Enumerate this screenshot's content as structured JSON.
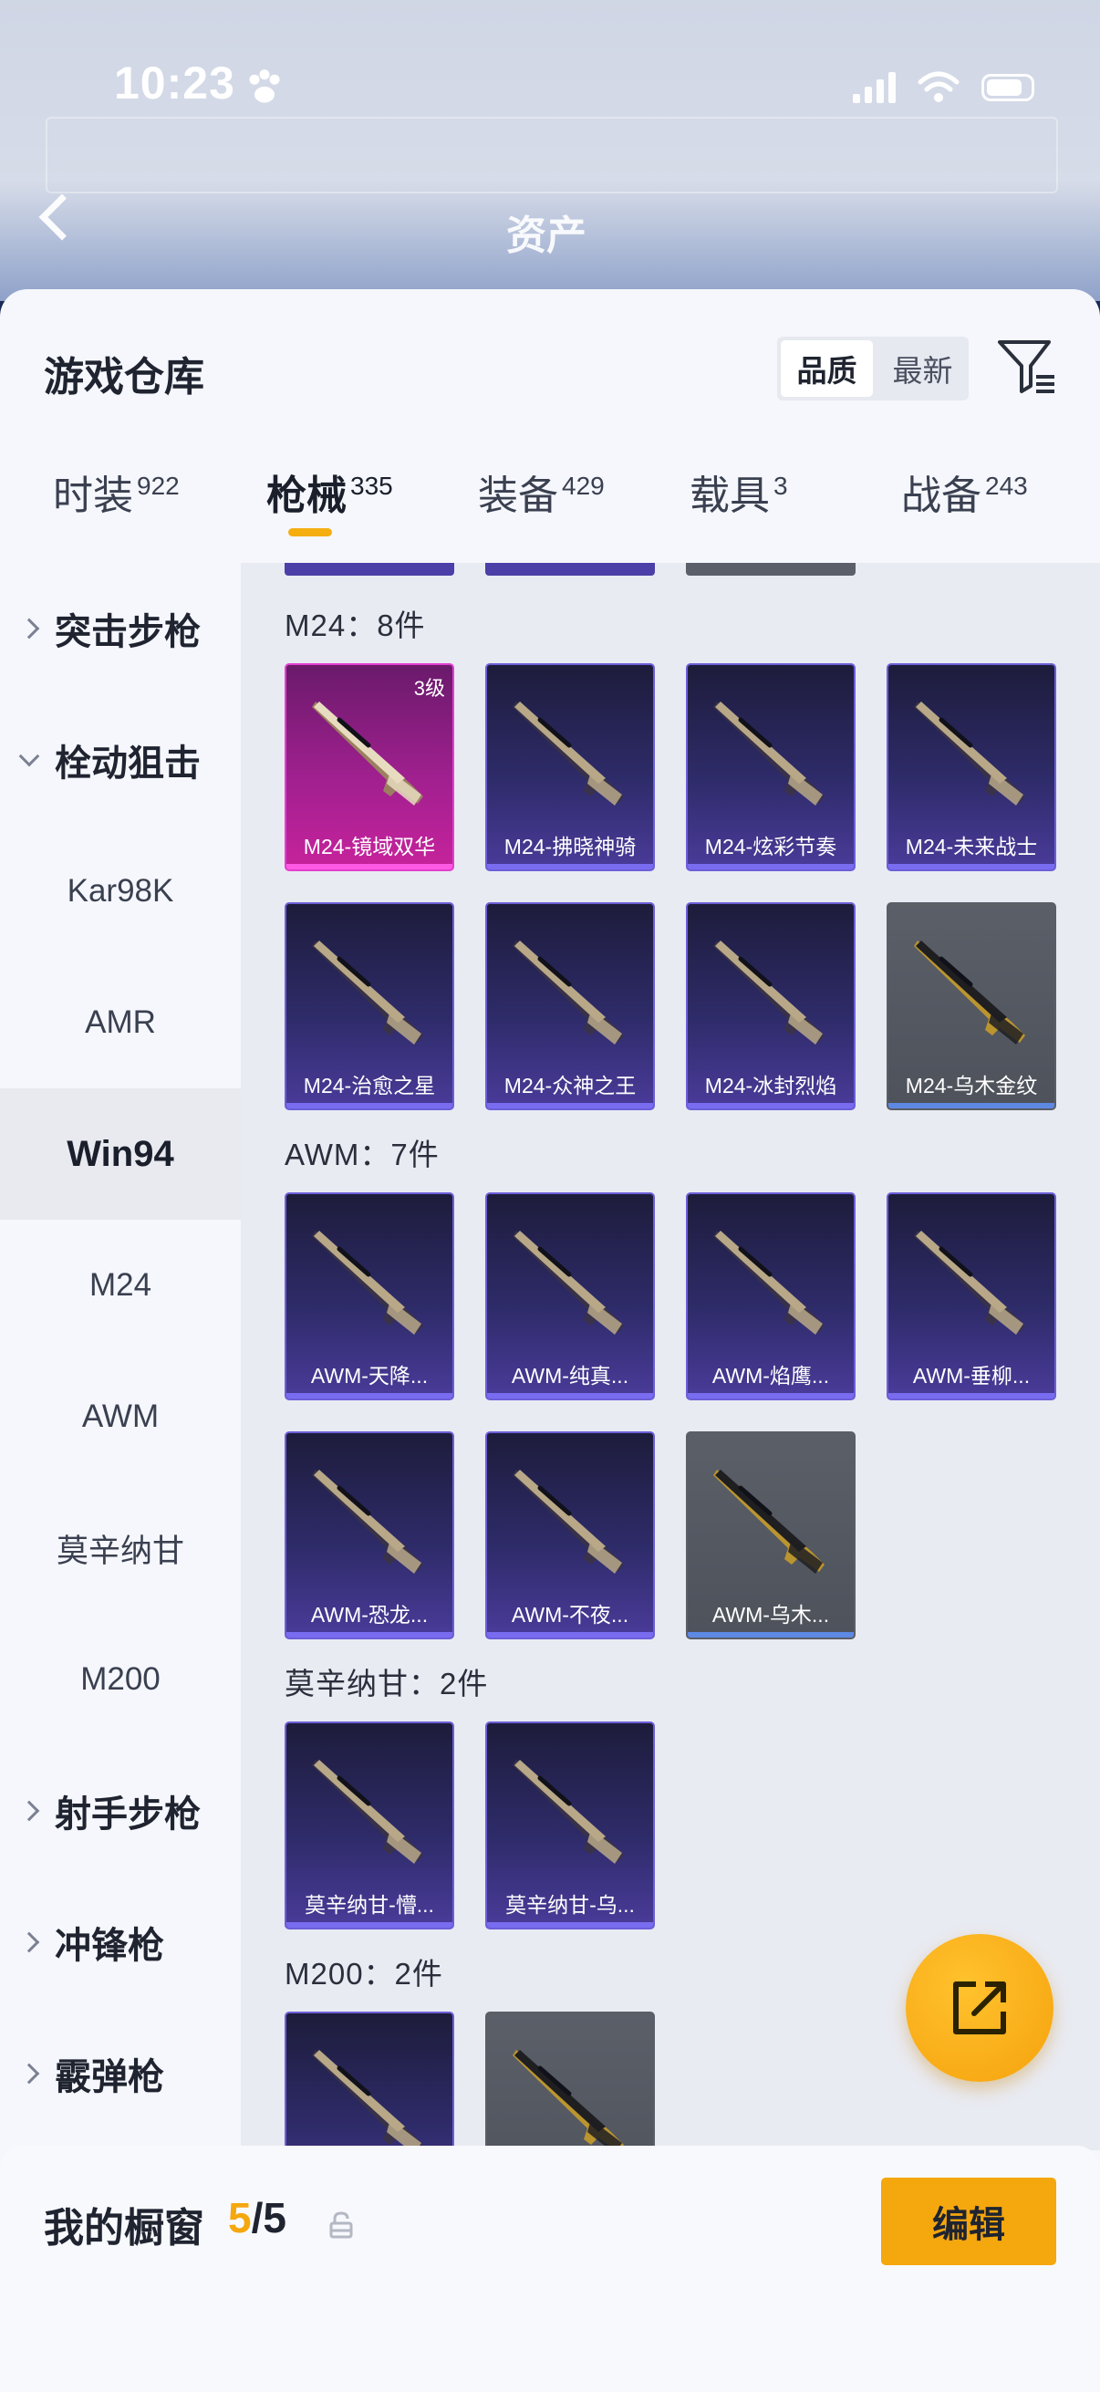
{
  "status_bar": {
    "time": "10:23"
  },
  "nav": {
    "title": "资产"
  },
  "sheet": {
    "title": "游戏仓库",
    "sort_options": [
      "品质",
      "最新"
    ],
    "sort_selected": "品质"
  },
  "tabs": [
    {
      "label": "时装",
      "count": "922"
    },
    {
      "label": "枪械",
      "count": "335",
      "active": true
    },
    {
      "label": "装备",
      "count": "429"
    },
    {
      "label": "载具",
      "count": "3"
    },
    {
      "label": "战备",
      "count": "243"
    }
  ],
  "sidebar": {
    "items": [
      {
        "label": "突击步枪",
        "type": "group",
        "state": "collapsed"
      },
      {
        "label": "栓动狙击",
        "type": "group",
        "state": "expanded"
      },
      {
        "label": "Kar98K"
      },
      {
        "label": "AMR"
      },
      {
        "label": "Win94",
        "active": true
      },
      {
        "label": "M24"
      },
      {
        "label": "AWM"
      },
      {
        "label": "莫辛纳甘"
      },
      {
        "label": "M200"
      },
      {
        "label": "射手步枪",
        "type": "group",
        "state": "collapsed"
      },
      {
        "label": "冲锋枪",
        "type": "group",
        "state": "collapsed"
      },
      {
        "label": "霰弹枪",
        "type": "group",
        "state": "collapsed"
      }
    ]
  },
  "sections": [
    {
      "title": "M24：8件",
      "items": [
        {
          "label": "M24-镜域双华",
          "rarity": "pink",
          "level": "3级"
        },
        {
          "label": "M24-拂晓神骑",
          "rarity": "purple"
        },
        {
          "label": "M24-炫彩节奏",
          "rarity": "purple"
        },
        {
          "label": "M24-未来战士",
          "rarity": "purple"
        },
        {
          "label": "M24-治愈之星",
          "rarity": "purple"
        },
        {
          "label": "M24-众神之王",
          "rarity": "purple"
        },
        {
          "label": "M24-冰封烈焰",
          "rarity": "purple"
        },
        {
          "label": "M24-乌木金纹",
          "rarity": "grey"
        }
      ]
    },
    {
      "title": "AWM：7件",
      "items": [
        {
          "label": "AWM-天降...",
          "rarity": "purple"
        },
        {
          "label": "AWM-纯真...",
          "rarity": "purple"
        },
        {
          "label": "AWM-焰鹰...",
          "rarity": "purple"
        },
        {
          "label": "AWM-垂柳...",
          "rarity": "purple"
        },
        {
          "label": "AWM-恐龙...",
          "rarity": "purple"
        },
        {
          "label": "AWM-不夜...",
          "rarity": "purple"
        },
        {
          "label": "AWM-乌木...",
          "rarity": "grey"
        }
      ]
    },
    {
      "title": "莫辛纳甘：2件",
      "items": [
        {
          "label": "莫辛纳甘-懵...",
          "rarity": "purple"
        },
        {
          "label": "莫辛纳甘-乌...",
          "rarity": "purple"
        }
      ]
    },
    {
      "title": "M200：2件",
      "items": [
        {
          "label": "",
          "rarity": "purple"
        },
        {
          "label": "",
          "rarity": "grey"
        }
      ]
    }
  ],
  "showcase": {
    "title": "我的橱窗",
    "current": "5",
    "total": "/5",
    "edit_label": "编辑"
  },
  "colors": {
    "accent": "#f5a70e",
    "pink_rarity": "#c7229c",
    "purple_rarity": "#4a3b9a",
    "grey_rarity": "#4e525b"
  }
}
